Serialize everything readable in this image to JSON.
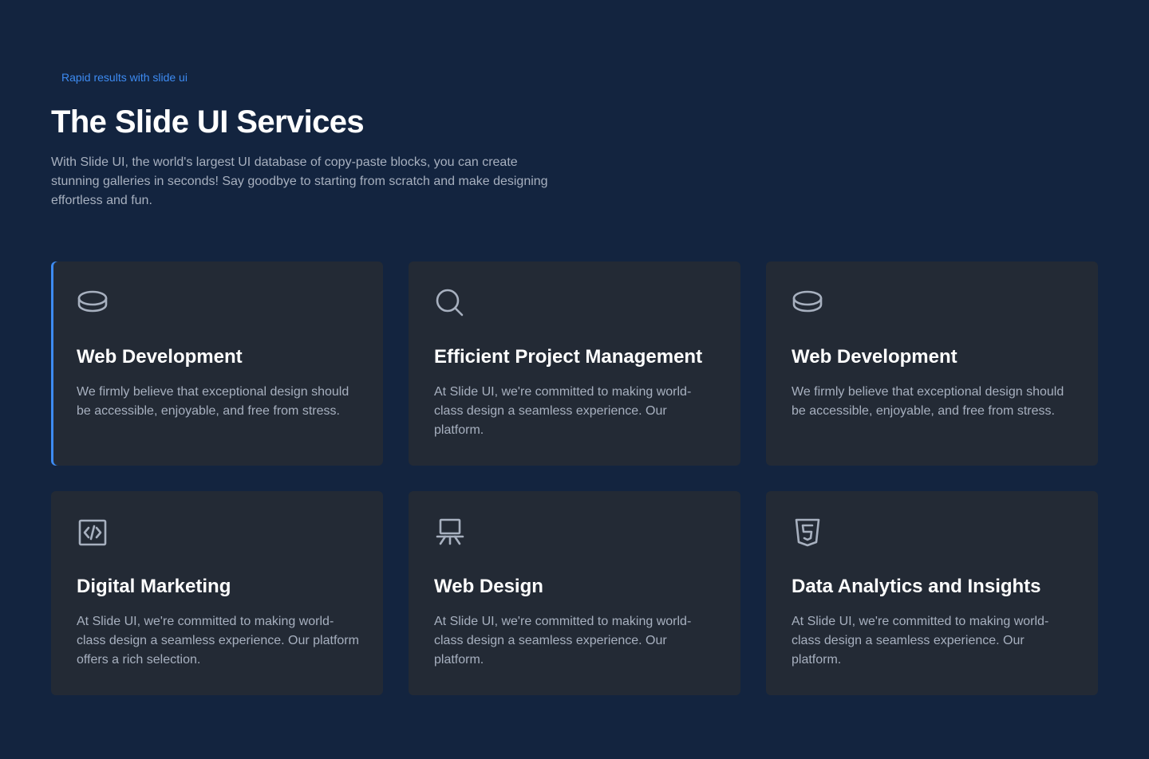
{
  "header": {
    "eyebrow": "Rapid results with slide ui",
    "title": "The Slide UI Services",
    "lead": "With Slide UI, the world's largest UI database of copy-paste blocks, you can create stunning galleries in seconds! Say goodbye to starting from scratch and make designing effortless and fun."
  },
  "colors": {
    "background": "#13243f",
    "card": "#232a35",
    "accent": "#3d8bf2",
    "muted_text": "#a7b0bf"
  },
  "cards": [
    {
      "icon": "database-icon",
      "title": "Web Development",
      "description": "We firmly believe that exceptional design should be accessible, enjoyable, and free from stress."
    },
    {
      "icon": "search-icon",
      "title": "Efficient Project Management",
      "description": "At Slide UI, we're committed to making world-class design a seamless experience. Our platform."
    },
    {
      "icon": "database-icon",
      "title": "Web Development",
      "description": "We firmly believe that exceptional design should be accessible, enjoyable, and free from stress."
    },
    {
      "icon": "code-file-icon",
      "title": "Digital Marketing",
      "description": "At Slide UI, we're committed to making world-class design a seamless experience. Our platform offers a rich selection."
    },
    {
      "icon": "presentation-icon",
      "title": "Web Design",
      "description": "At Slide UI, we're committed to making world-class design a seamless experience. Our platform."
    },
    {
      "icon": "html5-icon",
      "title": "Data Analytics and Insights",
      "description": "At Slide UI, we're committed to making world-class design a seamless experience. Our platform."
    }
  ]
}
